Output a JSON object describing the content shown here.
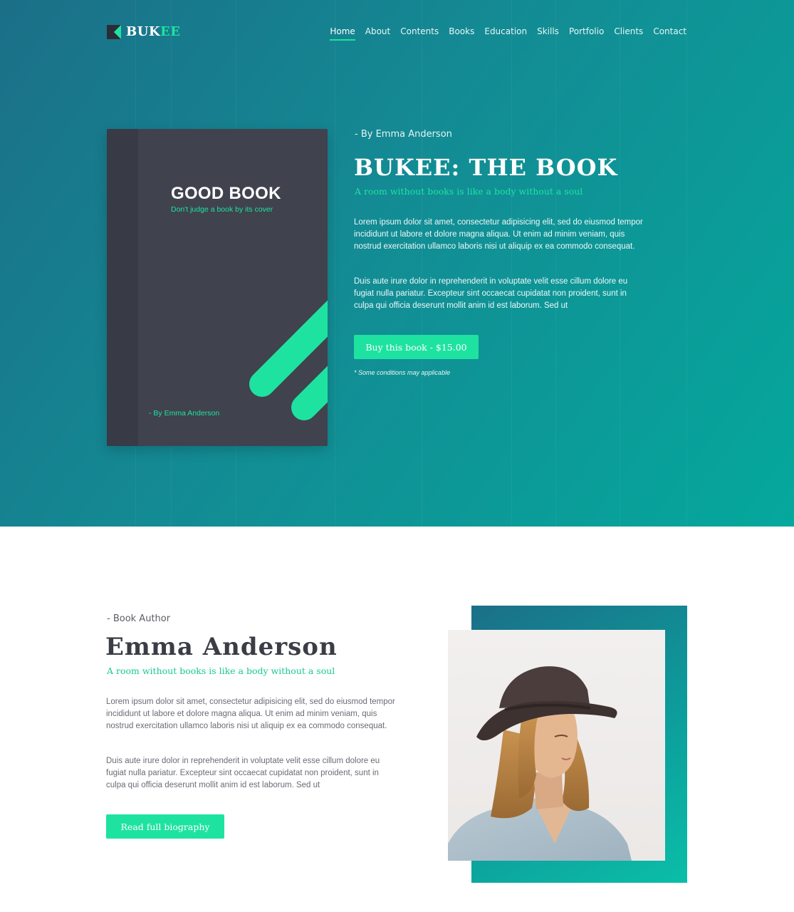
{
  "colors": {
    "accent": "#1ee3a0",
    "hero_gradient_start": "#1b6f88",
    "hero_gradient_end": "#05a89c",
    "book_cover": "#40424e",
    "dark_text": "#3b3d46"
  },
  "logo": {
    "text_white": "BUK",
    "text_green": "EE",
    "icon": "bookmark-flag-icon"
  },
  "nav": {
    "items": [
      "Home",
      "About",
      "Contents",
      "Books",
      "Education",
      "Skills",
      "Portfolio",
      "Clients",
      "Contact"
    ],
    "active": "Home"
  },
  "book": {
    "title": "GOOD BOOK",
    "tagline": "Don't judge a book by its cover",
    "author": "- By Emma Anderson"
  },
  "hero": {
    "by_line": "- By Emma Anderson",
    "title": "BUKEE: THE BOOK",
    "subtitle": "A room without books is like a body without a soul",
    "paragraph1": "Lorem ipsum dolor sit amet, consectetur adipisicing elit, sed do eiusmod tempor incididunt ut labore et dolore magna aliqua. Ut enim ad minim veniam, quis nostrud exercitation ullamco laboris nisi ut aliquip ex ea commodo consequat.",
    "paragraph2": "Duis aute irure dolor in reprehenderit in voluptate velit esse cillum dolore eu fugiat nulla pariatur. Excepteur sint occaecat cupidatat non proident, sunt in culpa qui officia deserunt mollit anim id est laborum. Sed ut",
    "buy_button": "Buy this book - $15.00",
    "conditions": "* Some conditions may applicable"
  },
  "author": {
    "label": "- Book Author",
    "name": "Emma Anderson",
    "subtitle": "A room without books is like a body without a soul",
    "paragraph1": "Lorem ipsum dolor sit amet, consectetur adipisicing elit, sed do eiusmod tempor incididunt ut labore et dolore magna aliqua. Ut enim ad minim veniam, quis nostrud exercitation ullamco laboris nisi ut aliquip ex ea commodo consequat.",
    "paragraph2": "Duis aute irure dolor in reprehenderit in voluptate velit esse cillum dolore eu fugiat nulla pariatur. Excepteur sint occaecat cupidatat non proident, sunt in culpa qui officia deserunt mollit anim id est laborum. Sed ut",
    "bio_button": "Read full biography"
  }
}
